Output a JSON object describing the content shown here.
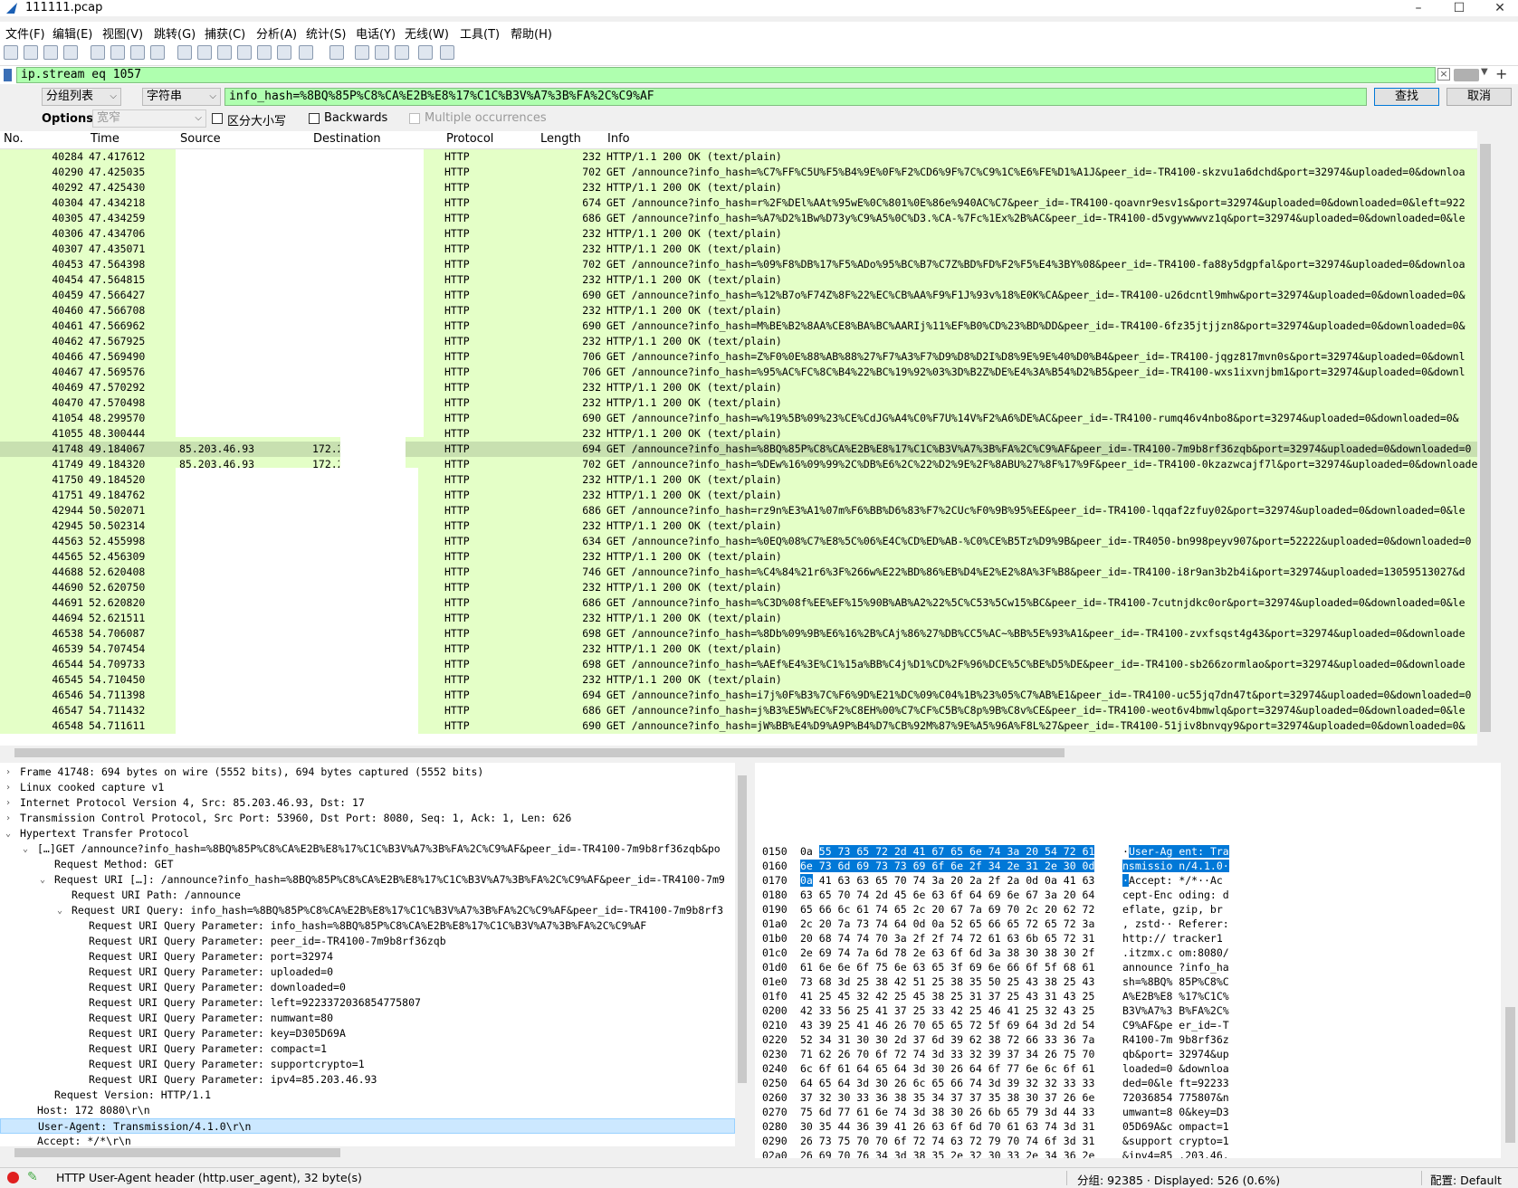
{
  "window": {
    "title": "111111.pcap",
    "minimize": "–",
    "maximize": "☐",
    "close": "✕"
  },
  "menu": [
    "文件(F)",
    "编辑(E)",
    "视图(V)",
    "跳转(G)",
    "捕获(C)",
    "分析(A)",
    "统计(S)",
    "电话(Y)",
    "无线(W)",
    "工具(T)",
    "帮助(H)"
  ],
  "filter": {
    "value": "ip.stream eq 1057"
  },
  "find": {
    "search_in": "分组列表",
    "search_type": "字符串",
    "query": "info_hash=%8BQ%85P%C8%CA%E2B%E8%17%C1C%B3V%A7%3B%FA%2C%C9%AF",
    "find_label": "查找",
    "cancel_label": "取消",
    "options_label": "Options:",
    "charset": "宽窄",
    "case_sensitive": "区分大小写",
    "backwards": "Backwards",
    "multiple": "Multiple occurrences"
  },
  "packet_list": {
    "columns": [
      "No.",
      "Time",
      "Source",
      "Destination",
      "Protocol",
      "Length",
      "Info"
    ],
    "rows": [
      [
        "40284",
        "47.417612",
        "",
        "",
        "HTTP",
        "232",
        "HTTP/1.1 200 OK  (text/plain)"
      ],
      [
        "40290",
        "47.425035",
        "",
        "",
        "HTTP",
        "702",
        "GET /announce?info_hash=%C7%FF%C5U%F5%B4%9E%0F%F2%CD6%9F%7C%C9%1C%E6%FE%D1%A1J&peer_id=-TR4100-skzvu1a6dchd&port=32974&uploaded=0&downloa"
      ],
      [
        "40292",
        "47.425430",
        "",
        "",
        "HTTP",
        "232",
        "HTTP/1.1 200 OK  (text/plain)"
      ],
      [
        "40304",
        "47.434218",
        "",
        "",
        "HTTP",
        "674",
        "GET /announce?info_hash=r%2F%DEl%AAt%95wE%0C%801%0E%86e%940AC%C7&peer_id=-TR4100-qoavnr9esv1s&port=32974&uploaded=0&downloaded=0&left=922"
      ],
      [
        "40305",
        "47.434259",
        "",
        "",
        "HTTP",
        "686",
        "GET /announce?info_hash=%A7%D2%1Bw%D73y%C9%A5%0C%D3.%CA-%7Fc%1Ex%2B%AC&peer_id=-TR4100-d5vgywwwvz1q&port=32974&uploaded=0&downloaded=0&le"
      ],
      [
        "40306",
        "47.434706",
        "",
        "",
        "HTTP",
        "232",
        "HTTP/1.1 200 OK  (text/plain)"
      ],
      [
        "40307",
        "47.435071",
        "",
        "",
        "HTTP",
        "232",
        "HTTP/1.1 200 OK  (text/plain)"
      ],
      [
        "40453",
        "47.564398",
        "",
        "",
        "HTTP",
        "702",
        "GET /announce?info_hash=%09%F8%DB%17%F5%ADo%95%BC%B7%C7Z%BD%FD%F2%F5%E4%3BY%08&peer_id=-TR4100-fa88y5dgpfal&port=32974&uploaded=0&downloa"
      ],
      [
        "40454",
        "47.564815",
        "",
        "",
        "HTTP",
        "232",
        "HTTP/1.1 200 OK  (text/plain)"
      ],
      [
        "40459",
        "47.566427",
        "",
        "",
        "HTTP",
        "690",
        "GET /announce?info_hash=%12%B7o%F74Z%8F%22%EC%CB%AA%F9%F1J%93v%18%E0K%CA&peer_id=-TR4100-u26dcntl9mhw&port=32974&uploaded=0&downloaded=0&"
      ],
      [
        "40460",
        "47.566708",
        "",
        "",
        "HTTP",
        "232",
        "HTTP/1.1 200 OK  (text/plain)"
      ],
      [
        "40461",
        "47.566962",
        "",
        "",
        "HTTP",
        "690",
        "GET /announce?info_hash=M%BE%B2%8AA%CE8%BA%BC%AARIj%11%EF%B0%CD%23%BD%DD&peer_id=-TR4100-6fz35jtjjzn8&port=32974&uploaded=0&downloaded=0&"
      ],
      [
        "40462",
        "47.567925",
        "",
        "",
        "HTTP",
        "232",
        "HTTP/1.1 200 OK  (text/plain)"
      ],
      [
        "40466",
        "47.569490",
        "",
        "",
        "HTTP",
        "706",
        "GET /announce?info_hash=Z%F0%0E%88%AB%88%27%F7%A3%F7%D9%D8%D2I%D8%9E%9E%40%D0%B4&peer_id=-TR4100-jqgz817mvn0s&port=32974&uploaded=0&downl"
      ],
      [
        "40467",
        "47.569576",
        "",
        "",
        "HTTP",
        "706",
        "GET /announce?info_hash=%95%AC%FC%8C%B4%22%BC%19%92%03%3D%B2Z%DE%E4%3A%B54%D2%B5&peer_id=-TR4100-wxs1ixvnjbm1&port=32974&uploaded=0&downl"
      ],
      [
        "40469",
        "47.570292",
        "",
        "",
        "HTTP",
        "232",
        "HTTP/1.1 200 OK  (text/plain)"
      ],
      [
        "40470",
        "47.570498",
        "",
        "",
        "HTTP",
        "232",
        "HTTP/1.1 200 OK  (text/plain)"
      ],
      [
        "41054",
        "48.299570",
        "",
        "",
        "HTTP",
        "690",
        "GET /announce?info_hash=w%19%5B%09%23%CE%CdJG%A4%C0%F7U%14V%F2%A6%DE%AC&peer_id=-TR4100-rumq46v4nbo8&port=32974&uploaded=0&downloaded=0&"
      ],
      [
        "41055",
        "48.300444",
        "",
        "",
        "HTTP",
        "232",
        "HTTP/1.1 200 OK  (text/plain)"
      ],
      [
        "41748",
        "49.184067",
        "85.203.46.93",
        "172.2",
        "HTTP",
        "694",
        "GET /announce?info_hash=%8BQ%85P%C8%CA%E2B%E8%17%C1C%B3V%A7%3B%FA%2C%C9%AF&peer_id=-TR4100-7m9b8rf36zqb&port=32974&uploaded=0&downloaded=0"
      ],
      [
        "41749",
        "49.184320",
        "85.203.46.93",
        "172.2",
        "HTTP",
        "702",
        "GET /announce?info_hash=%DEw%16%09%99%2C%DB%E6%2C%22%D2%9E%2F%8ABU%27%8F%17%9F&peer_id=-TR4100-0kzazwcajf7l&port=32974&uploaded=0&downloaded=0"
      ],
      [
        "41750",
        "49.184520",
        "",
        "",
        "HTTP",
        "232",
        "HTTP/1.1 200 OK  (text/plain)"
      ],
      [
        "41751",
        "49.184762",
        "",
        "",
        "HTTP",
        "232",
        "HTTP/1.1 200 OK  (text/plain)"
      ],
      [
        "42944",
        "50.502071",
        "",
        "",
        "HTTP",
        "686",
        "GET /announce?info_hash=rz9n%E3%A1%07m%F6%BB%D6%83%F7%2CUc%F0%9B%95%EE&peer_id=-TR4100-lqqaf2zfuy02&port=32974&uploaded=0&downloaded=0&le"
      ],
      [
        "42945",
        "50.502314",
        "",
        "",
        "HTTP",
        "232",
        "HTTP/1.1 200 OK  (text/plain)"
      ],
      [
        "44563",
        "52.455998",
        "",
        "",
        "HTTP",
        "634",
        "GET /announce?info_hash=%0EQ%08%C7%E8%5C%06%E4C%CD%ED%AB-%C0%CE%B5Tz%D9%9B&peer_id=-TR4050-bn998peyv907&port=52222&uploaded=0&downloaded=0"
      ],
      [
        "44565",
        "52.456309",
        "",
        "",
        "HTTP",
        "232",
        "HTTP/1.1 200 OK  (text/plain)"
      ],
      [
        "44688",
        "52.620408",
        "",
        "",
        "HTTP",
        "746",
        "GET /announce?info_hash=%C4%84%21r6%3F%266w%E22%BD%86%EB%D4%E2%E2%8A%3F%B8&peer_id=-TR4100-i8r9an3b2b4i&port=32974&uploaded=13059513027&d"
      ],
      [
        "44690",
        "52.620750",
        "",
        "",
        "HTTP",
        "232",
        "HTTP/1.1 200 OK  (text/plain)"
      ],
      [
        "44691",
        "52.620820",
        "",
        "",
        "HTTP",
        "686",
        "GET /announce?info_hash=%C3D%08f%EE%EF%15%90B%AB%A2%22%5C%C53%5Cw15%BC&peer_id=-TR4100-7cutnjdkc0or&port=32974&uploaded=0&downloaded=0&le"
      ],
      [
        "44694",
        "52.621511",
        "",
        "",
        "HTTP",
        "232",
        "HTTP/1.1 200 OK  (text/plain)"
      ],
      [
        "46538",
        "54.706087",
        "",
        "",
        "HTTP",
        "698",
        "GET /announce?info_hash=%8Db%09%9B%E6%16%2B%CAj%86%27%DB%CC5%AC~%BB%5E%93%A1&peer_id=-TR4100-zvxfsqst4g43&port=32974&uploaded=0&downloade"
      ],
      [
        "46539",
        "54.707454",
        "",
        "",
        "HTTP",
        "232",
        "HTTP/1.1 200 OK  (text/plain)"
      ],
      [
        "46544",
        "54.709733",
        "",
        "",
        "HTTP",
        "698",
        "GET /announce?info_hash=%AEf%E4%3E%C1%15a%BB%C4j%D1%CD%2F%96%DCE%5C%BE%D5%DE&peer_id=-TR4100-sb266zormlao&port=32974&uploaded=0&downloade"
      ],
      [
        "46545",
        "54.710450",
        "",
        "",
        "HTTP",
        "232",
        "HTTP/1.1 200 OK  (text/plain)"
      ],
      [
        "46546",
        "54.711398",
        "",
        "",
        "HTTP",
        "694",
        "GET /announce?info_hash=i7j%0F%B3%7C%F6%9D%E21%DC%09%C04%1B%23%05%C7%AB%E1&peer_id=-TR4100-uc55jq7dn47t&port=32974&uploaded=0&downloaded=0"
      ],
      [
        "46547",
        "54.711432",
        "",
        "",
        "HTTP",
        "686",
        "GET /announce?info_hash=j%B3%E5W%EC%F2%C8EH%00%C7%CF%C5B%C8p%9B%C8v%CE&peer_id=-TR4100-weot6v4bmwlq&port=32974&uploaded=0&downloaded=0&le"
      ],
      [
        "46548",
        "54.711611",
        "",
        "",
        "HTTP",
        "690",
        "GET /announce?info_hash=jW%BB%E4%D9%A9P%B4%D7%CB%92M%87%9E%A5%96A%F8L%27&peer_id=-TR4100-51jiv8bnvqy9&port=32974&uploaded=0&downloaded=0&"
      ]
    ]
  },
  "details": [
    {
      "t": "›",
      "text": "Frame 41748: 694 bytes on wire (5552 bits), 694 bytes captured (5552 bits)",
      "i": 0
    },
    {
      "t": "›",
      "text": "Linux cooked capture v1",
      "i": 0
    },
    {
      "t": "›",
      "text": "Internet Protocol Version 4, Src: 85.203.46.93, Dst: 17",
      "i": 0
    },
    {
      "t": "›",
      "text": "Transmission Control Protocol, Src Port: 53960, Dst Port: 8080, Seq: 1, Ack: 1, Len: 626",
      "i": 0
    },
    {
      "t": "⌄",
      "text": "Hypertext Transfer Protocol",
      "i": 0
    },
    {
      "t": "⌄",
      "text": "[…]GET /announce?info_hash=%8BQ%85P%C8%CA%E2B%E8%17%C1C%B3V%A7%3B%FA%2C%C9%AF&peer_id=-TR4100-7m9b8rf36zqb&po",
      "i": 1
    },
    {
      "t": "",
      "text": "Request Method: GET",
      "i": 2
    },
    {
      "t": "⌄",
      "text": "Request URI […]: /announce?info_hash=%8BQ%85P%C8%CA%E2B%E8%17%C1C%B3V%A7%3B%FA%2C%C9%AF&peer_id=-TR4100-7m9",
      "i": 2
    },
    {
      "t": "",
      "text": "Request URI Path: /announce",
      "i": 3
    },
    {
      "t": "⌄",
      "text": "Request URI Query: info_hash=%8BQ%85P%C8%CA%E2B%E8%17%C1C%B3V%A7%3B%FA%2C%C9%AF&peer_id=-TR4100-7m9b8rf3",
      "i": 3
    },
    {
      "t": "",
      "text": "Request URI Query Parameter: info_hash=%8BQ%85P%C8%CA%E2B%E8%17%C1C%B3V%A7%3B%FA%2C%C9%AF",
      "i": 4
    },
    {
      "t": "",
      "text": "Request URI Query Parameter: peer_id=-TR4100-7m9b8rf36zqb",
      "i": 4
    },
    {
      "t": "",
      "text": "Request URI Query Parameter: port=32974",
      "i": 4
    },
    {
      "t": "",
      "text": "Request URI Query Parameter: uploaded=0",
      "i": 4
    },
    {
      "t": "",
      "text": "Request URI Query Parameter: downloaded=0",
      "i": 4
    },
    {
      "t": "",
      "text": "Request URI Query Parameter: left=9223372036854775807",
      "i": 4
    },
    {
      "t": "",
      "text": "Request URI Query Parameter: numwant=80",
      "i": 4
    },
    {
      "t": "",
      "text": "Request URI Query Parameter: key=D305D69A",
      "i": 4
    },
    {
      "t": "",
      "text": "Request URI Query Parameter: compact=1",
      "i": 4
    },
    {
      "t": "",
      "text": "Request URI Query Parameter: supportcrypto=1",
      "i": 4
    },
    {
      "t": "",
      "text": "Request URI Query Parameter: ipv4=85.203.46.93",
      "i": 4
    },
    {
      "t": "",
      "text": "Request Version: HTTP/1.1",
      "i": 2
    },
    {
      "t": "",
      "text": "Host: 172          8080\\r\\n",
      "i": 1
    },
    {
      "t": "",
      "text": "User-Agent: Transmission/4.1.0\\r\\n",
      "i": 1,
      "sel": true
    },
    {
      "t": "",
      "text": "Accept: */*\\r\\n",
      "i": 1
    }
  ],
  "bytes": [
    [
      "0150",
      "0a",
      "55 73 65 72 2d 41 67  65 6e 74 3a 20 54 72 61",
      "",
      "User-Ag ent: Tra"
    ],
    [
      "0160",
      "",
      "6e 73 6d 69 73 73 69 6f  6e 2f 34 2e 31 2e 30 0d",
      "",
      "nsmissio n/4.1.0·"
    ],
    [
      "0170",
      "0a",
      "",
      "41 63 63 65 70 74 3a  20 2a 2f 2a 0d 0a 41 63",
      "·",
      "Accept:  */*··Ac"
    ],
    [
      "0180",
      "",
      "",
      "63 65 70 74 2d 45 6e 63  6f 64 69 6e 67 3a 20 64",
      "",
      "cept-Enc oding: d"
    ],
    [
      "0190",
      "",
      "",
      "65 66 6c 61 74 65 2c 20  67 7a 69 70 2c 20 62 72",
      "",
      "eflate,  gzip, br"
    ],
    [
      "01a0",
      "",
      "",
      "2c 20 7a 73 74 64 0d 0a  52 65 66 65 72 65 72 3a",
      "",
      ", zstd·· Referer:"
    ],
    [
      "01b0",
      "",
      "",
      "20 68 74 74 70 3a 2f 2f  74 72 61 63 6b 65 72 31",
      "",
      " http:// tracker1"
    ],
    [
      "01c0",
      "",
      "",
      "2e 69 74 7a 6d 78 2e 63  6f 6d 3a 38 30 38 30 2f",
      "",
      ".itzmx.c om:8080/"
    ],
    [
      "01d0",
      "",
      "",
      "61 6e 6e 6f 75 6e 63 65  3f 69 6e 66 6f 5f 68 61",
      "",
      "announce ?info_ha"
    ],
    [
      "01e0",
      "",
      "",
      "73 68 3d 25 38 42 51 25  38 35 50 25 43 38 25 43",
      "",
      "sh=%8BQ% 85P%C8%C"
    ],
    [
      "01f0",
      "",
      "",
      "41 25 45 32 42 25 45 38  25 31 37 25 43 31 43 25",
      "",
      "A%E2B%E8 %17%C1C%"
    ],
    [
      "0200",
      "",
      "",
      "42 33 56 25 41 37 25 33  42 25 46 41 25 32 43 25",
      "",
      "B3V%A7%3 B%FA%2C%"
    ],
    [
      "0210",
      "",
      "",
      "43 39 25 41 46 26 70 65  65 72 5f 69 64 3d 2d 54",
      "",
      "C9%AF&pe er_id=-T"
    ],
    [
      "0220",
      "",
      "",
      "52 34 31 30 30 2d 37 6d  39 62 38 72 66 33 36 7a",
      "",
      "R4100-7m 9b8rf36z"
    ],
    [
      "0230",
      "",
      "",
      "71 62 26 70 6f 72 74 3d  33 32 39 37 34 26 75 70",
      "",
      "qb&port= 32974&up"
    ],
    [
      "0240",
      "",
      "",
      "6c 6f 61 64 65 64 3d 30  26 64 6f 77 6e 6c 6f 61",
      "",
      "loaded=0 &downloa"
    ],
    [
      "0250",
      "",
      "",
      "64 65 64 3d 30 26 6c 65  66 74 3d 39 32 32 33 33",
      "",
      "ded=0&le ft=92233"
    ],
    [
      "0260",
      "",
      "",
      "37 32 30 33 36 38 35 34  37 37 35 38 30 37 26 6e",
      "",
      "72036854 775807&n"
    ],
    [
      "0270",
      "",
      "",
      "75 6d 77 61 6e 74 3d 38  30 26 6b 65 79 3d 44 33",
      "",
      "umwant=8 0&key=D3"
    ],
    [
      "0280",
      "",
      "",
      "30 35 44 36 39 41 26 63  6f 6d 70 61 63 74 3d 31",
      "",
      "05D69A&c ompact=1"
    ],
    [
      "0290",
      "",
      "",
      "26 73 75 70 70 6f 72 74  63 72 79 70 74 6f 3d 31",
      "",
      "&support crypto=1"
    ],
    [
      "02a0",
      "",
      "",
      "26 69 70 76 34 3d 38 35  2e 32 30 33 2e 34 36 2e",
      "",
      "&ipv4=85 .203.46."
    ],
    [
      "02b0",
      "",
      "",
      "39 33 0d 0a 0d 0a",
      "",
      "93····"
    ]
  ],
  "status": {
    "field": "HTTP User-Agent header (http.user_agent), 32 byte(s)",
    "packets": "分组: 92385 · Displayed: 526 (0.6%)",
    "profile": "配置: Default"
  },
  "colors": {
    "http_row": "#e4ffc7",
    "filter_ok": "#afffaf",
    "byte_highlight": "#0078d7"
  }
}
